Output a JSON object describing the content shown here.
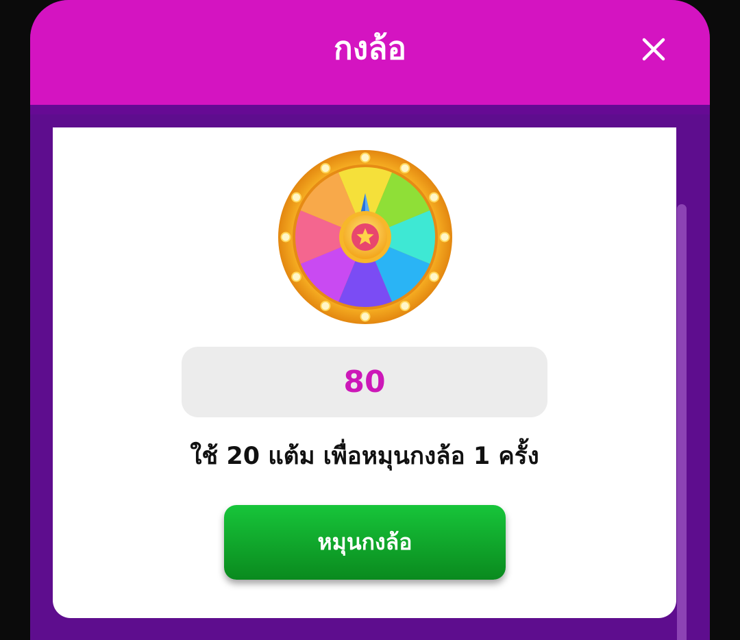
{
  "dialog": {
    "title": "กงล้อ",
    "close_icon": "close-icon"
  },
  "wheel": {
    "icon": "prize-wheel-icon",
    "segment_colors": [
      "#f5e03a",
      "#8fdf37",
      "#3ee8d4",
      "#2ab4f5",
      "#7b4cf4",
      "#c94af2",
      "#f4668f",
      "#f8a94a"
    ],
    "rim_color": "#f7a91e",
    "center_icon": "star-icon"
  },
  "points": {
    "value": "80"
  },
  "instruction": "ใช้ 20 แต้ม เพื่อหมุนกงล้อ 1 ครั้ง",
  "spin_button": {
    "label": "หมุนกงล้อ"
  },
  "colors": {
    "header": "#d414c1",
    "frame": "#5e0d8e",
    "points_text": "#cc18b8",
    "button": "#12a72e"
  }
}
